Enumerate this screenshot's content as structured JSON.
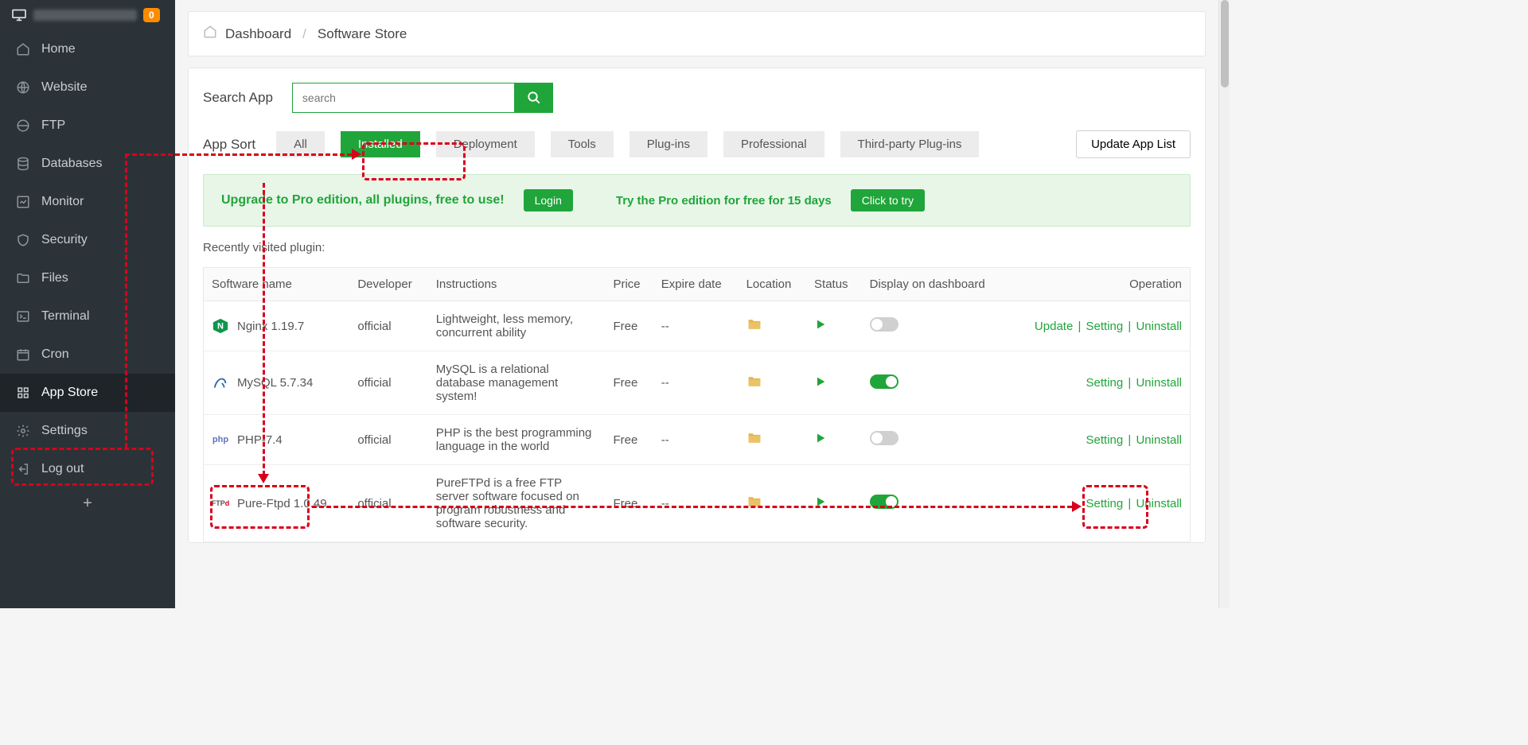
{
  "top_badge": "0",
  "sidebar": {
    "items": [
      {
        "label": "Home"
      },
      {
        "label": "Website"
      },
      {
        "label": "FTP"
      },
      {
        "label": "Databases"
      },
      {
        "label": "Monitor"
      },
      {
        "label": "Security"
      },
      {
        "label": "Files"
      },
      {
        "label": "Terminal"
      },
      {
        "label": "Cron"
      },
      {
        "label": "App Store"
      },
      {
        "label": "Settings"
      },
      {
        "label": "Log out"
      }
    ]
  },
  "breadcrumb": {
    "home": "Dashboard",
    "current": "Software Store"
  },
  "search": {
    "label": "Search App",
    "placeholder": "search"
  },
  "sort": {
    "label": "App Sort",
    "tabs": [
      "All",
      "Installed",
      "Deployment",
      "Tools",
      "Plug-ins",
      "Professional",
      "Third-party Plug-ins"
    ],
    "active": "Installed",
    "update_btn": "Update App List"
  },
  "promo": {
    "text1": "Upgrade to Pro edition, all plugins, free to use!",
    "login": "Login",
    "text2": "Try the Pro edition for free for 15 days",
    "try": "Click to try"
  },
  "recent_label": "Recently visited plugin:",
  "table": {
    "headers": [
      "Software name",
      "Developer",
      "Instructions",
      "Price",
      "Expire date",
      "Location",
      "Status",
      "Display on dashboard",
      "Operation"
    ],
    "rows": [
      {
        "name": "Nginx 1.19.7",
        "icon": "nginx",
        "dev": "official",
        "instr": "Lightweight, less memory, concurrent ability",
        "price": "Free",
        "expire": "--",
        "display": "off",
        "ops": [
          "Update",
          "Setting",
          "Uninstall"
        ]
      },
      {
        "name": "MySQL 5.7.34",
        "icon": "mysql",
        "dev": "official",
        "instr": "MySQL is a relational database management system!",
        "price": "Free",
        "expire": "--",
        "display": "on",
        "ops": [
          "Setting",
          "Uninstall"
        ]
      },
      {
        "name": "PHP-7.4",
        "icon": "php",
        "dev": "official",
        "instr": "PHP is the best programming language in the world",
        "price": "Free",
        "expire": "--",
        "display": "off",
        "ops": [
          "Setting",
          "Uninstall"
        ]
      },
      {
        "name": "Pure-Ftpd 1.0.49",
        "icon": "ftp",
        "dev": "official",
        "instr": "PureFTPd is a free FTP server software focused on program robustness and software security.",
        "price": "Free",
        "expire": "--",
        "display": "on",
        "ops": [
          "Setting",
          "Uninstall"
        ]
      }
    ]
  }
}
